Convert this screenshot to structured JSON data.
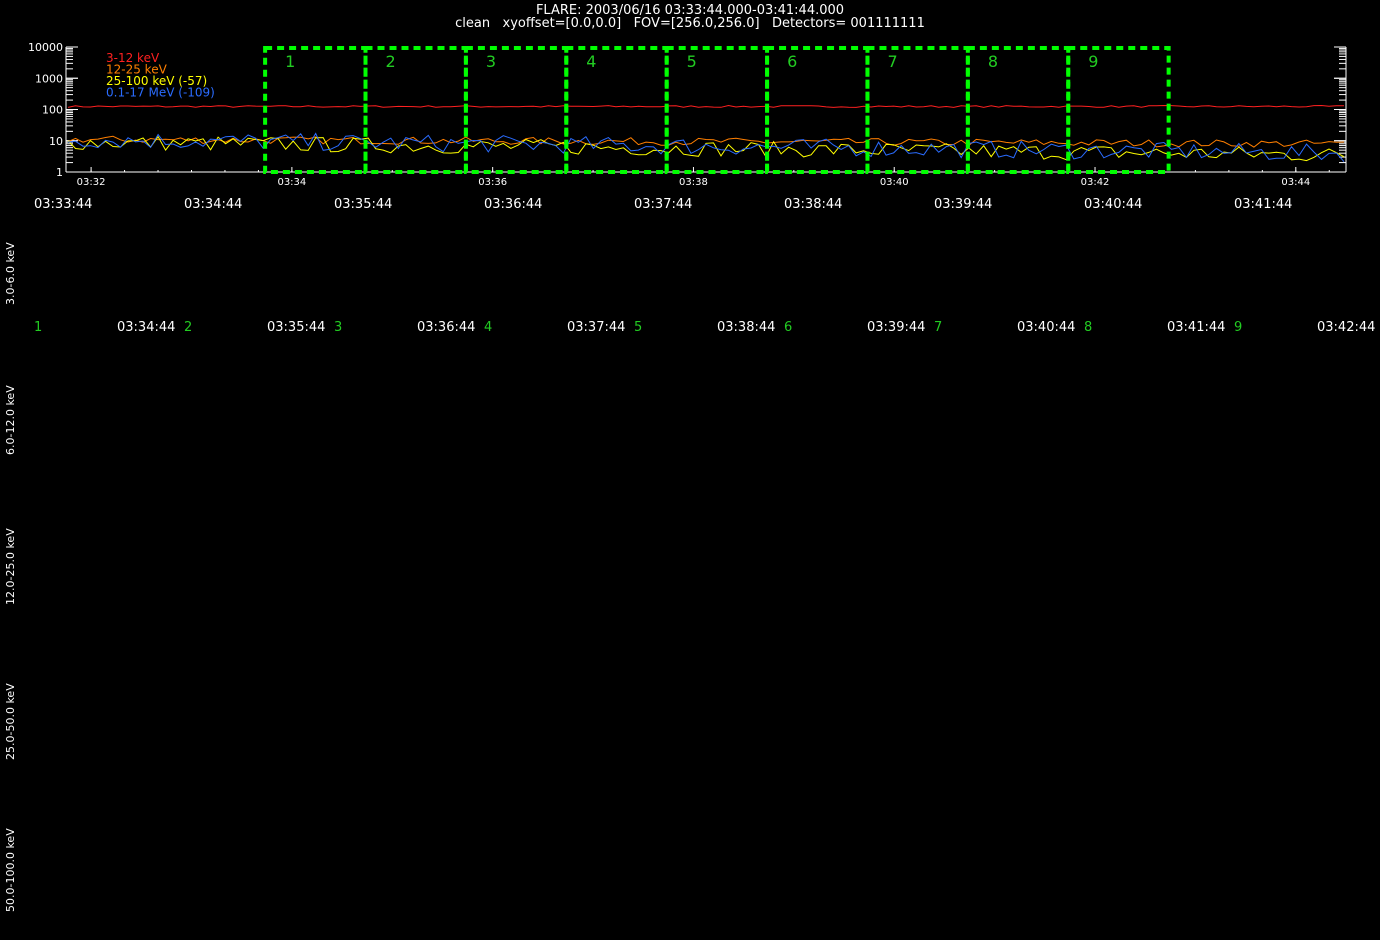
{
  "header": {
    "line1": "FLARE: 2003/06/16 03:33:44.000-03:41:44.000",
    "line2": "clean   xyoffset=[0.0,0.0]   FOV=[256.0,256.0]   Detectors= 001111111"
  },
  "chart_data": {
    "type": "line",
    "y_scale": "log",
    "ylim": [
      1,
      10000
    ],
    "y_ticks": [
      "10000",
      "1000",
      "100",
      "10",
      "1"
    ],
    "x_ticks": [
      "03:32",
      "03:34",
      "03:36",
      "03:38",
      "03:40",
      "03:42",
      "03:44"
    ],
    "xlim": [
      "03:31:45",
      "03:44:30"
    ],
    "legend_position": "top-left",
    "series": [
      {
        "name": "3-12 keV",
        "color": "#ff2020",
        "level": 125,
        "noise": 0.03
      },
      {
        "name": "12-25 keV",
        "color": "#ff7f00",
        "start": 11,
        "end": 8,
        "noise": 0.12
      },
      {
        "name": "25-100 keV (-57)",
        "color": "#ffff00",
        "start": 9,
        "end": 3.5,
        "noise": 0.25
      },
      {
        "name": "0.1-17 MeV (-109)",
        "color": "#2a6cff",
        "start": 11,
        "end": 4,
        "noise": 0.28
      }
    ],
    "intervals": [
      {
        "label": "1",
        "start": "03:33:44",
        "end": "03:34:44"
      },
      {
        "label": "2",
        "start": "03:34:44",
        "end": "03:35:44"
      },
      {
        "label": "3",
        "start": "03:35:44",
        "end": "03:36:44"
      },
      {
        "label": "4",
        "start": "03:36:44",
        "end": "03:37:44"
      },
      {
        "label": "5",
        "start": "03:37:44",
        "end": "03:38:44"
      },
      {
        "label": "6",
        "start": "03:38:44",
        "end": "03:39:44"
      },
      {
        "label": "7",
        "start": "03:39:44",
        "end": "03:40:44"
      },
      {
        "label": "8",
        "start": "03:40:44",
        "end": "03:41:44"
      },
      {
        "label": "9",
        "start": "03:41:44",
        "end": "03:42:44"
      }
    ],
    "interval_color": "#00ff00"
  },
  "start_times": [
    "03:33:44",
    "03:34:44",
    "03:35:44",
    "03:36:44",
    "03:37:44",
    "03:38:44",
    "03:39:44",
    "03:40:44",
    "03:41:44"
  ],
  "image_row": {
    "numbers": [
      "1",
      "2",
      "3",
      "4",
      "5",
      "6",
      "7",
      "8",
      "9"
    ],
    "end_times": [
      "03:34:44",
      "03:35:44",
      "03:36:44",
      "03:37:44",
      "03:38:44",
      "03:39:44",
      "03:40:44",
      "03:41:44",
      "03:42:44"
    ]
  },
  "energy_bands": [
    "3.0-6.0 keV",
    "6.0-12.0 keV",
    "12.0-25.0 keV",
    "25.0-50.0 keV",
    "50.0-100.0 keV"
  ]
}
